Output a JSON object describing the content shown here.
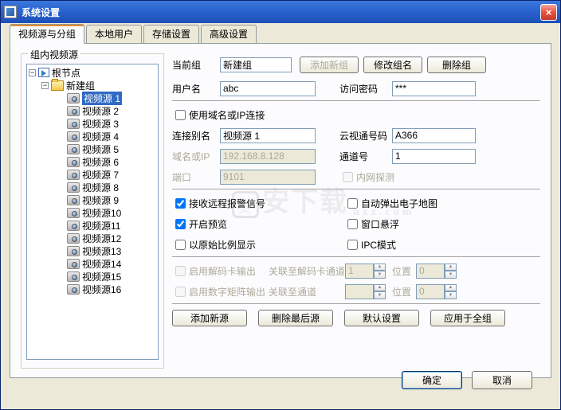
{
  "window": {
    "title": "系统设置"
  },
  "tabs": {
    "t0": "视频源与分组",
    "t1": "本地用户",
    "t2": "存储设置",
    "t3": "高级设置"
  },
  "groupbox": {
    "title": "组内视频源"
  },
  "tree": {
    "root": "根节点",
    "group": "新建组",
    "items": [
      "视频源 1",
      "视频源 2",
      "视频源 3",
      "视频源 4",
      "视频源 5",
      "视频源 6",
      "视频源 7",
      "视频源 8",
      "视频源 9",
      "视频源10",
      "视频源11",
      "视频源12",
      "视频源13",
      "视频源14",
      "视频源15",
      "视频源16"
    ]
  },
  "labels": {
    "currentGroup": "当前组",
    "addNewGroup": "添加新组",
    "editGroupName": "修改组名",
    "deleteGroup": "删除组",
    "userName": "用户名",
    "password": "访问密码",
    "useDomain": "使用域名或IP连接",
    "alias": "连接别名",
    "cloudCh": "云视通号码",
    "domainIp": "域名或IP",
    "channel": "通道号",
    "port": "端口",
    "intranet": "内网探测",
    "recvAlarm": "接收远程报警信号",
    "autoMap": "自动弹出电子地图",
    "preview": "开启预览",
    "floatWin": "窗口悬浮",
    "origRatio": "以原始比例显示",
    "ipcMode": "IPC模式",
    "enableDecode": "启用解码卡输出",
    "linkDecode": "关联至解码卡通道",
    "pos": "位置",
    "enableMatrix": "启用数字矩阵输出",
    "linkChannel": "关联至通道",
    "addSrc": "添加新源",
    "delLast": "删除最后源",
    "defaults": "默认设置",
    "applyAll": "应用于全组",
    "ok": "确定",
    "cancel": "取消"
  },
  "values": {
    "currentGroup": "新建组",
    "userName": "abc",
    "password": "***",
    "alias": "视频源 1",
    "cloudCh": "A366",
    "domainIp": "192.168.8.128",
    "channel": "1",
    "port": "9101",
    "useDomain": false,
    "recvAlarm": true,
    "autoMap": false,
    "preview": true,
    "floatWin": false,
    "origRatio": false,
    "ipcMode": false,
    "enableDecode": false,
    "decodeCh": "1",
    "decodePos": "0",
    "enableMatrix": false,
    "matrixCh": "",
    "matrixPos": "0"
  },
  "watermark": {
    "text": "安下载",
    "sub": "nxz.com"
  }
}
